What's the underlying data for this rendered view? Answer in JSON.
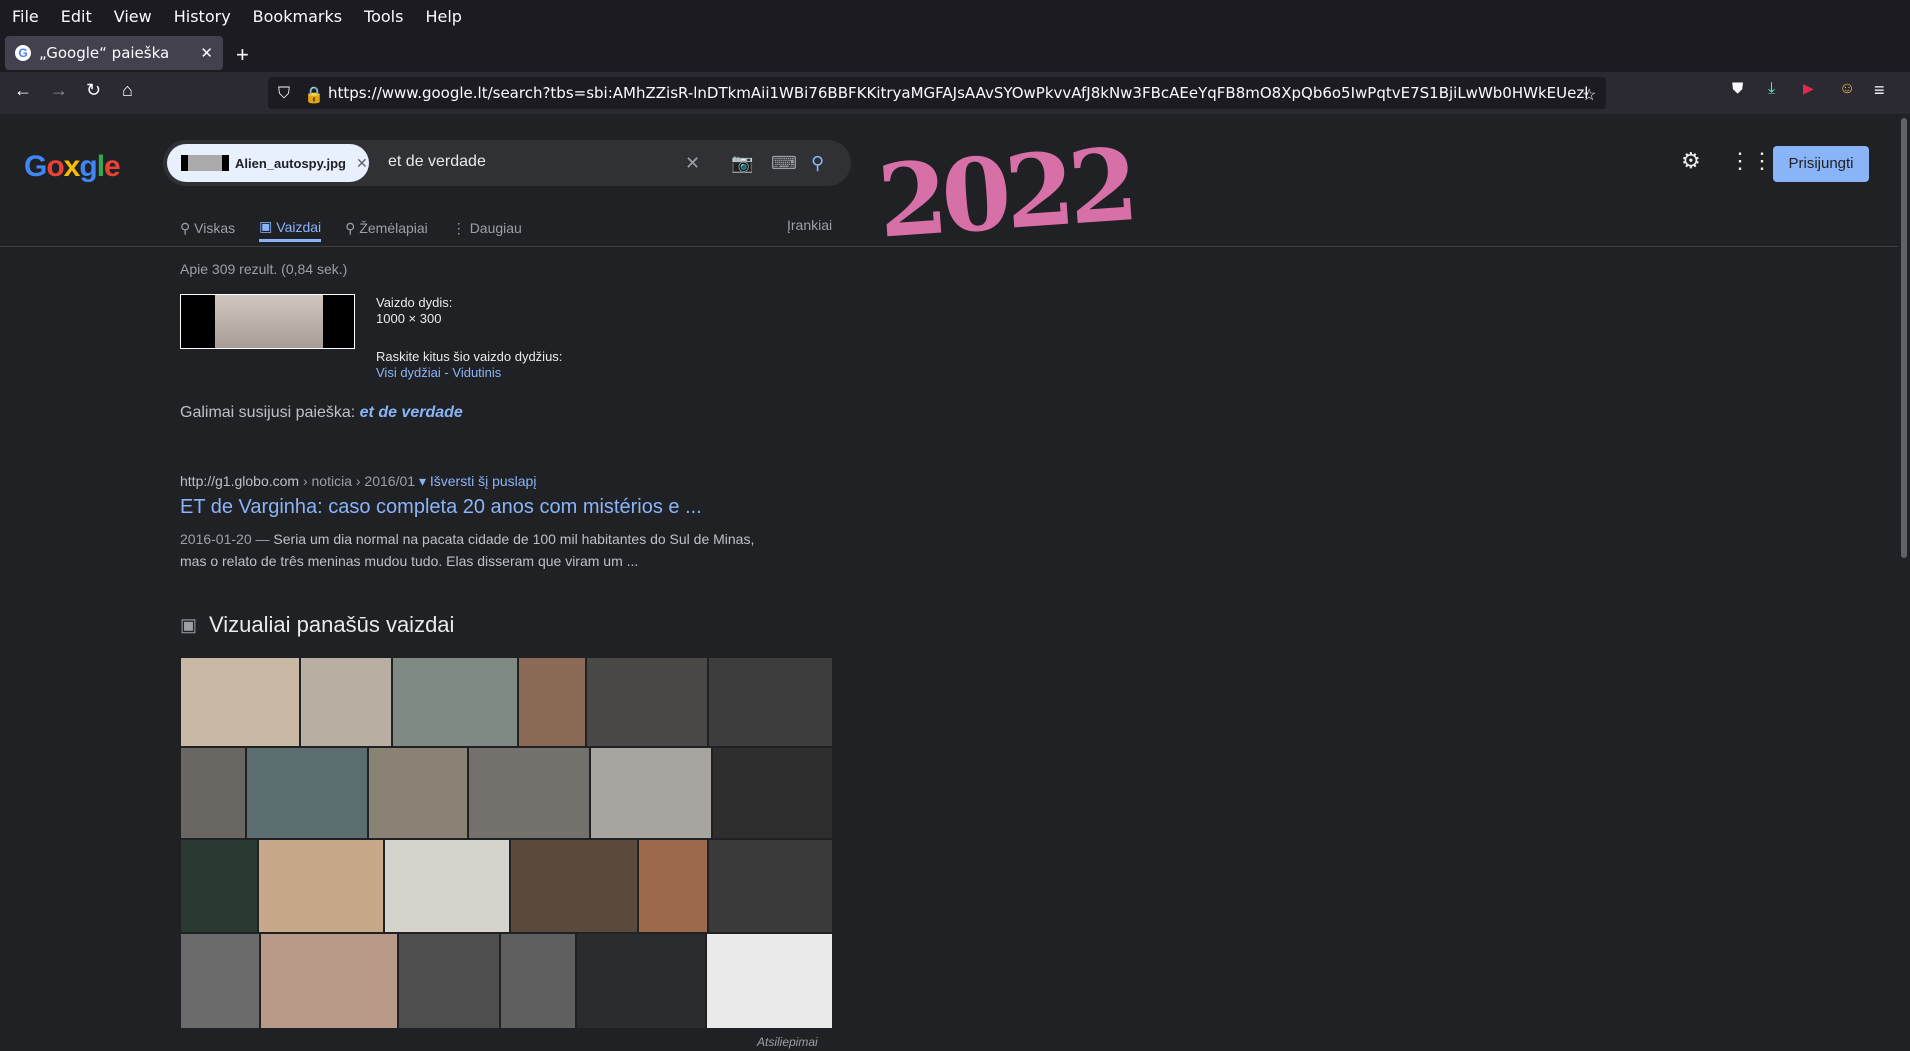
{
  "browser": {
    "menu": [
      "File",
      "Edit",
      "View",
      "History",
      "Bookmarks",
      "Tools",
      "Help"
    ],
    "tab_title": "„Google“ paieška",
    "tab_close": "✕",
    "new_tab": "+",
    "url": "https://www.google.lt/search?tbs=sbi:AMhZZisR-lnDTkmAii1WBi76BBFKKitryaMGFAJsAAvSYOwPkvvAfJ8kNw3FBcAEeYqFB8mO8XpQb6o5IwPqtvE7S1BjiLwWb0HWkEUezkRfqBgV"
  },
  "search": {
    "chip_label": "Alien_autospy.jpg",
    "chip_close": "✕",
    "query": "et de verdade",
    "clear": "✕"
  },
  "header": {
    "doodle_text": "2022",
    "signin": "Prisijungti"
  },
  "tabs": [
    "Viskas",
    "Vaizdai",
    "Žemėlapiai",
    "Daugiau"
  ],
  "tools_label": "Įrankiai",
  "results_count": "Apie 309 rezult. (0,84 sek.)",
  "image_info": {
    "size_label": "Vaizdo dydis:",
    "size_value": "1000 × 300",
    "other_sizes_label": "Raskite kitus šio vaizdo dydžius:",
    "all_sizes": "Visi dydžiai",
    "separator": "-",
    "medium": "Vidutinis"
  },
  "related": {
    "label": "Galimai susijusi paieška:",
    "term": "et de verdade"
  },
  "result": {
    "site": "http://g1.globo.com",
    "path": " › noticia › 2016/01",
    "translate": "▾ Išversti šį puslapį",
    "title": "ET de Varginha: caso completa 20 anos com mistérios e ...",
    "date": "2016-01-20 —",
    "snippet": "Seria um dia normal na pacata cidade de 100 mil habitantes do Sul de Minas, mas o relato de três meninas mudou tudo. Elas disseram que viram um ..."
  },
  "similar": {
    "heading": "Vizualiai panašūs vaizdai",
    "feedback": "Atsiliepimai"
  },
  "colors": {
    "accent": "#8ab4f8",
    "bg": "#202124",
    "doodle": "#d870a8"
  }
}
